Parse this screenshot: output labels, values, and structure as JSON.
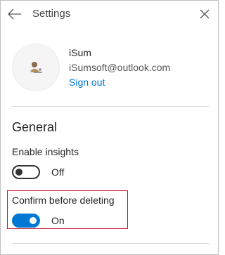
{
  "header": {
    "title": "Settings",
    "back_icon": "back-arrow-icon",
    "close_icon": "close-icon"
  },
  "account": {
    "name": "iSum",
    "email": "iSumsoft@outlook.com",
    "sign_out_label": "Sign out",
    "avatar_icon": "avatar-icon"
  },
  "general": {
    "section_title": "General",
    "settings": [
      {
        "label": "Enable insights",
        "state_label": "Off",
        "enabled": false
      },
      {
        "label": "Confirm before deleting",
        "state_label": "On",
        "enabled": true
      }
    ]
  },
  "colors": {
    "accent": "#0078d4",
    "highlight_box": "#c8102e",
    "toggle_off": "#333333"
  }
}
